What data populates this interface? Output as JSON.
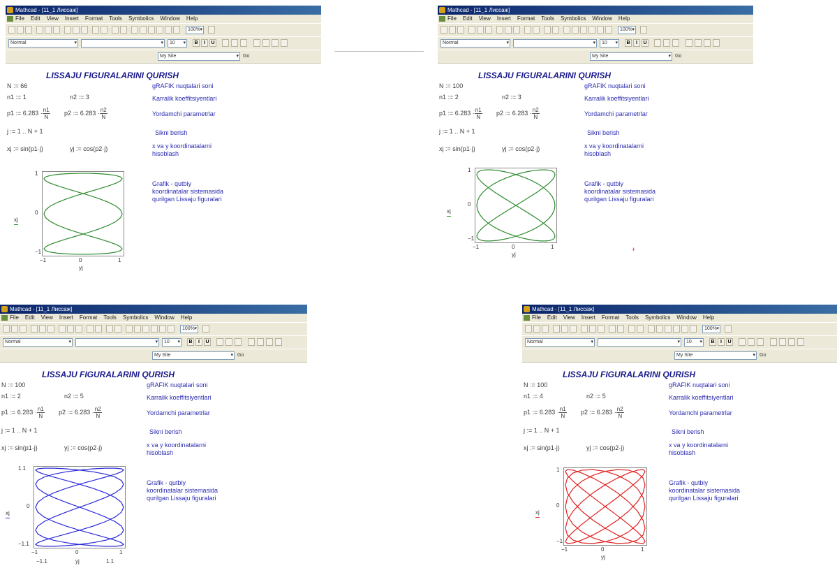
{
  "window": {
    "title_a": "Mathcad - [11_1 Лиссаж]",
    "title_b": "Mathcad - [11_1 Лиссаж]",
    "title_c": "Mathcad - [11_1 Лиссаж]",
    "title_d": "Mathcad - [11_1 Лиссаж]"
  },
  "menu": [
    "File",
    "Edit",
    "View",
    "Insert",
    "Format",
    "Tools",
    "Symbolics",
    "Window",
    "Help"
  ],
  "toolbar": {
    "style": "Normal",
    "font_size": "10",
    "zoom": "100%",
    "resource": "My Site",
    "go": "Go",
    "bold": "B",
    "italic": "I",
    "underline": "U"
  },
  "common": {
    "heading": "LISSAJU FIGURALARINI QURISH",
    "n_sym": "N",
    "p1_pre": "p1 := 6.283 ·",
    "p2_pre": "p2 := 6.283 ·",
    "n1_num": "n1",
    "n2_num": "n2",
    "range": "j := 1 .. N + 1",
    "x_def": "xj := sin(p1·j)",
    "y_def": "yj := cos(p2·j)",
    "note_points": "gRAFIK nuqtalari soni",
    "note_coeffs": "Karralik koeffitsiyentlari",
    "note_params": "Yordamchi parametrlar",
    "note_step": "Sikni berish",
    "note_coords_1": "x va y koordinatalarni",
    "note_coords_2": "hisoblash",
    "note_graph_1": "Grafik - qutbiy",
    "note_graph_2": "koordinatalar sistemasida",
    "note_graph_3": "qurilgan Lissaju figuralari",
    "xaxis": "yj",
    "yaxis": "xj"
  },
  "panels": [
    {
      "id": "a",
      "N": "N := 66",
      "n1": "n1 := 1",
      "n2": "n2 := 3",
      "nx": 1,
      "ny": 3,
      "points": 66,
      "color": "#2e8b2e",
      "yticks": [
        "1",
        "0",
        "−1"
      ],
      "xticks": [
        "−1",
        "0",
        "1"
      ]
    },
    {
      "id": "b",
      "N": "N := 100",
      "n1": "n1 := 2",
      "n2": "n2 := 3",
      "nx": 2,
      "ny": 3,
      "points": 100,
      "color": "#2e8b2e",
      "yticks": [
        "1",
        "0",
        "−1"
      ],
      "xticks": [
        "−1",
        "0",
        "1"
      ]
    },
    {
      "id": "c",
      "N": "N := 100",
      "n1": "n1 := 2",
      "n2": "n2 := 5",
      "nx": 2,
      "ny": 5,
      "points": 100,
      "color": "#2a2ad8",
      "yticks": [
        "1.1",
        "0",
        "−1.1"
      ],
      "xticks": [
        "−1",
        "0",
        "1"
      ],
      "xticks2": [
        "−1.1",
        "1.1"
      ]
    },
    {
      "id": "d",
      "N": "N := 100",
      "n1": "n1 := 4",
      "n2": "n2 := 5",
      "nx": 4,
      "ny": 5,
      "points": 100,
      "color": "#e02020",
      "yticks": [
        "1",
        "0",
        "−1"
      ],
      "xticks": [
        "−1",
        "0",
        "1"
      ]
    }
  ]
}
